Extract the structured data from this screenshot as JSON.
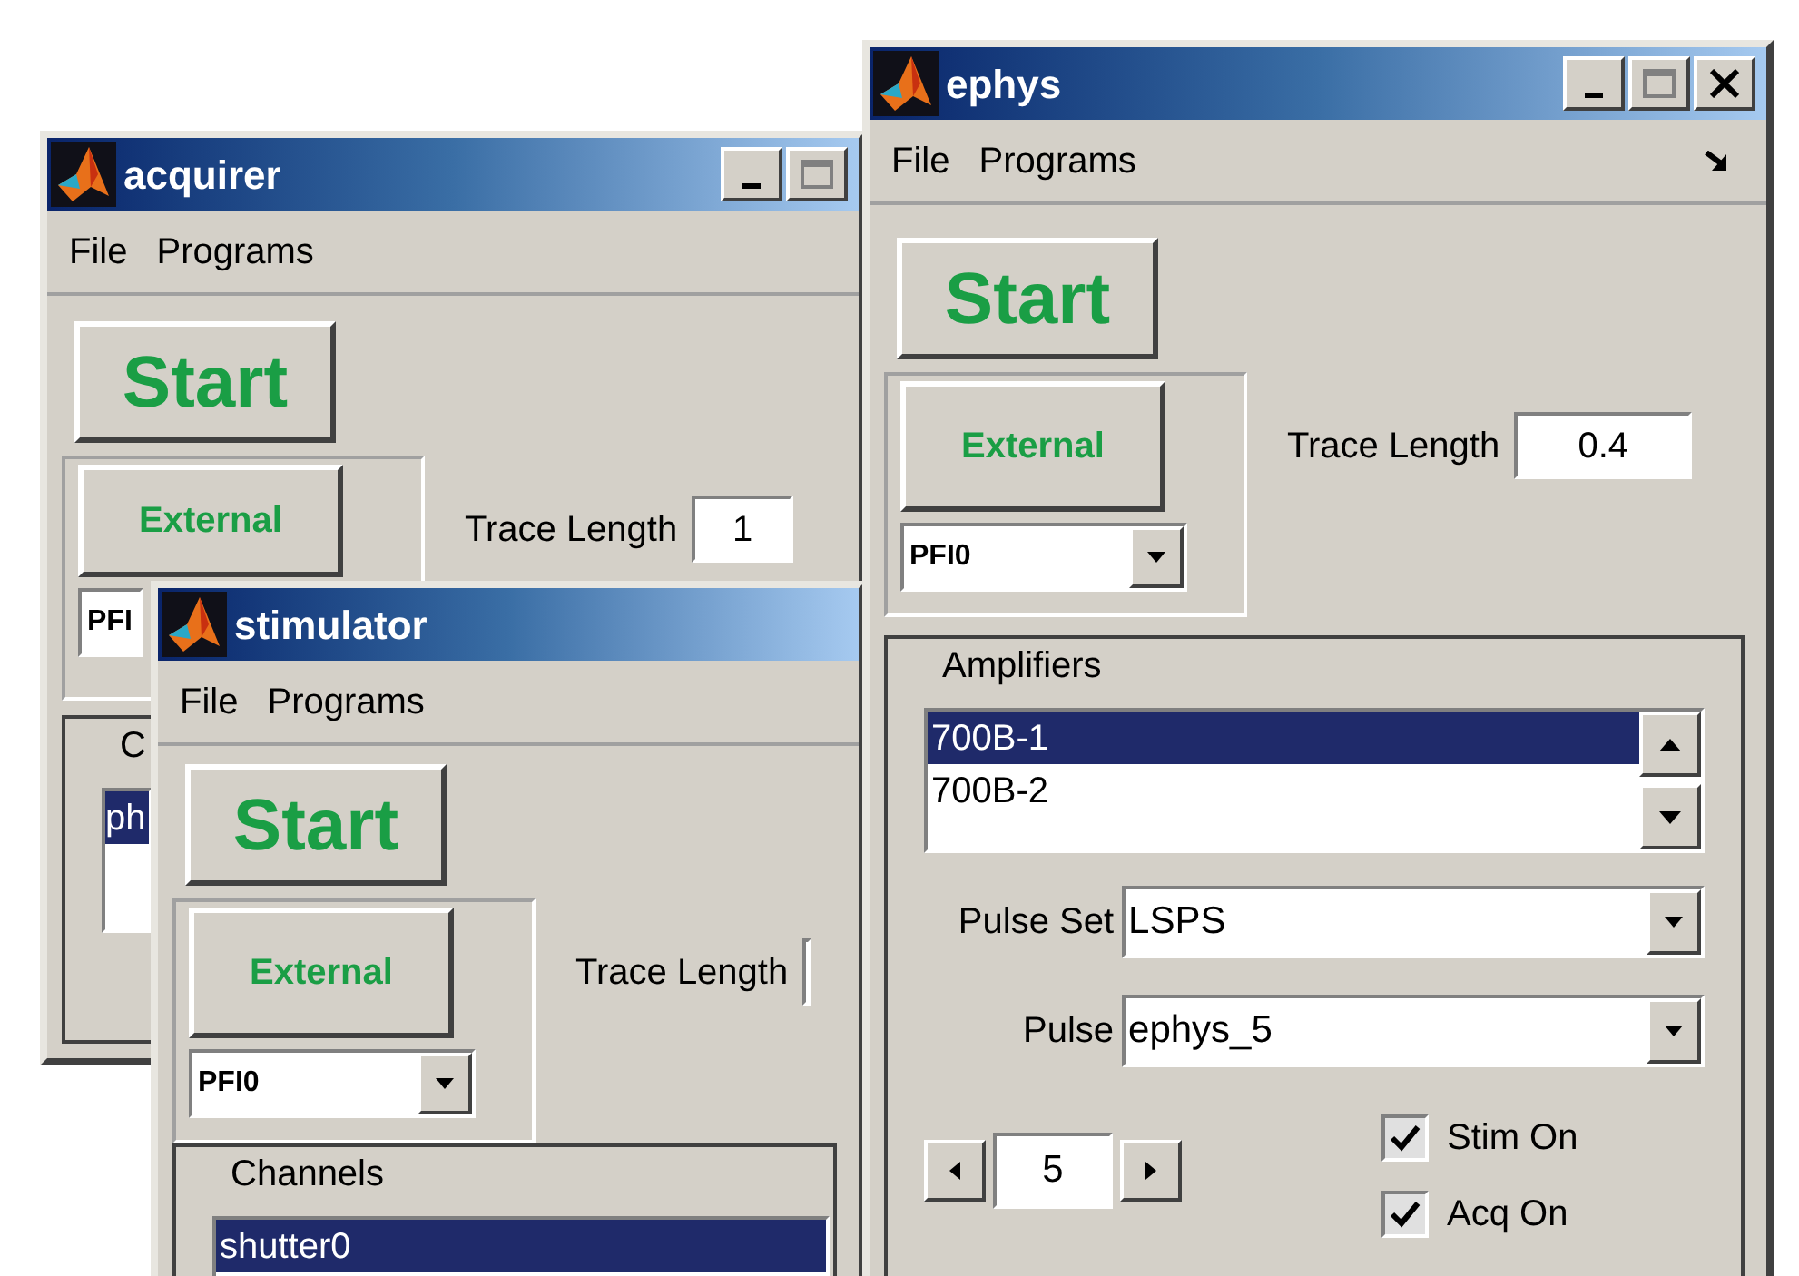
{
  "windows": [
    {
      "title": "acquirer",
      "title_buttons": [
        {
          "kind": "minimize"
        },
        {
          "kind": "maximize"
        }
      ],
      "menu": [
        "File",
        "Programs"
      ],
      "start_button": "Start",
      "trigger_button": "External",
      "trigger_source": {
        "value": "PFI",
        "arrow": false
      },
      "trace_length": {
        "label": "Trace Length",
        "value": "1"
      },
      "group": {
        "label": "C",
        "list": {
          "items": [
            {
              "label": "ph",
              "selected": true
            }
          ],
          "scroll_arrows": false
        }
      }
    },
    {
      "title": "stimulator",
      "menu": [
        "File",
        "Programs"
      ],
      "start_button": "Start",
      "trigger_button": "External",
      "trigger_source": {
        "value": "PFI0",
        "arrow": true
      },
      "trace_length": {
        "label": "Trace Length"
      },
      "group": {
        "label": "Channels",
        "list": {
          "items": [
            {
              "label": "shutter0",
              "selected": true
            }
          ],
          "scroll_arrows": false
        }
      }
    },
    {
      "title": "ephys",
      "title_buttons": [
        {
          "kind": "minimize"
        },
        {
          "kind": "maximize"
        },
        {
          "kind": "close"
        }
      ],
      "menu": [
        "File",
        "Programs"
      ],
      "dock_arrow": true,
      "start_button": "Start",
      "trigger_button": "External",
      "trigger_source": {
        "value": "PFI0",
        "arrow": true
      },
      "trace_length": {
        "label": "Trace Length",
        "value": "0.4"
      },
      "group": {
        "label": "Amplifiers",
        "list": {
          "items": [
            {
              "label": "700B-1",
              "selected": true
            },
            {
              "label": "700B-2",
              "selected": false
            }
          ],
          "scroll_arrows": true
        },
        "selects": [
          {
            "label": "Pulse Set",
            "value": "LSPS"
          },
          {
            "label": "Pulse",
            "value": "ephys_5"
          }
        ],
        "stepper": {
          "value": "5"
        },
        "checkboxes": [
          {
            "label": "Stim On",
            "checked": true
          },
          {
            "label": "Acq On",
            "checked": true
          }
        ]
      }
    }
  ]
}
